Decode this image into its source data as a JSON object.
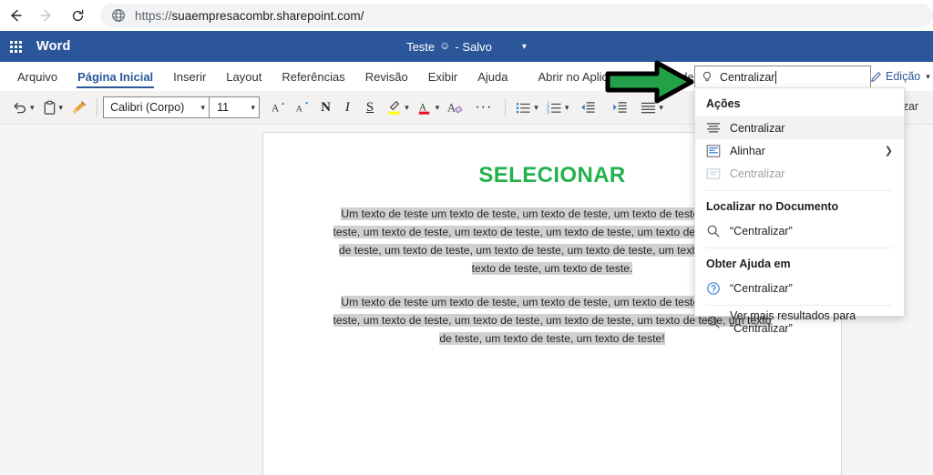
{
  "browser": {
    "back_icon": "arrow-left-icon",
    "forward_icon": "arrow-right-icon",
    "reload_icon": "reload-icon",
    "globe_icon": "globe-icon",
    "url_scheme": "https://",
    "url_host": "suaempresacombr.sharepoint.com/"
  },
  "header": {
    "waffle_icon": "app-launcher-icon",
    "app_name": "Word",
    "doc_name": "Teste",
    "person_icon": "person-icon",
    "save_state": "- Salvo",
    "chevron_icon": "chevron-down-icon"
  },
  "ribbon": {
    "tabs": [
      {
        "label": "Arquivo",
        "active": false
      },
      {
        "label": "Página Inicial",
        "active": true
      },
      {
        "label": "Inserir",
        "active": false
      },
      {
        "label": "Layout",
        "active": false
      },
      {
        "label": "Referências",
        "active": false
      },
      {
        "label": "Revisão",
        "active": false
      },
      {
        "label": "Exibir",
        "active": false
      },
      {
        "label": "Ajuda",
        "active": false
      }
    ],
    "open_in_desktop": "Abrir no Aplicativo da Área de Trabalho",
    "reutilizar_partial": "eutilizar"
  },
  "search": {
    "bulb_icon": "lightbulb-icon",
    "value": "Centralizar"
  },
  "edit_button": {
    "pencil_icon": "pencil-icon",
    "label": "Edição",
    "chevron_icon": "chevron-down-icon"
  },
  "toolbar": {
    "undo_icon": "undo-icon",
    "paste_icon": "paste-icon",
    "format_painter_icon": "format-painter-icon",
    "font_name": "Calibri (Corpo)",
    "font_size": "11",
    "grow_font_icon": "grow-font-icon",
    "shrink_font_icon": "shrink-font-icon",
    "bold_label": "N",
    "italic_label": "I",
    "underline_label": "S",
    "highlight_icon": "text-highlight-icon",
    "font_color_icon": "font-color-icon",
    "clear_format_icon": "clear-formatting-icon",
    "more_label": "···",
    "bullets_icon": "bullet-list-icon",
    "numbering_icon": "numbered-list-icon",
    "decrease_indent_icon": "decrease-indent-icon",
    "increase_indent_icon": "increase-indent-icon",
    "align_icon": "align-icon",
    "highlight_color": "#ffff00",
    "font_color": "#e81123"
  },
  "document": {
    "heading": "SELECIONAR",
    "heading_color": "#22b14c",
    "paragraph1": "Um texto de teste um texto de teste, um texto de teste, um texto de teste, um texto de teste, um texto de teste, um texto de teste, um texto de teste, um texto de teste, um texto de teste, um texto de teste, um texto de teste, um texto de teste, um texto de teste, um texto de teste, um texto de teste.",
    "paragraph2": "Um texto de teste um texto de teste, um texto de teste, um texto de teste, um texto de teste, um texto de teste, um texto de teste, um texto de teste, um texto de teste, um texto de teste, um texto de teste, um texto de teste!",
    "selection_color": "#d0d0d0"
  },
  "search_panel": {
    "actions_header": "Ações",
    "action_centralizar": "Centralizar",
    "action_alinhar": "Alinhar",
    "action_centralizar_disabled": "Centralizar",
    "center_icon": "align-center-icon",
    "align_icon": "align-box-icon",
    "center_disabled_icon": "align-center-disabled-icon",
    "submenu_chevron": "chevron-right-icon",
    "find_header": "Localizar no Documento",
    "find_item": "“Centralizar”",
    "find_icon": "search-icon",
    "help_header": "Obter Ajuda em",
    "help_item": "“Centralizar”",
    "help_icon": "question-circle-icon",
    "more_results": "Ver mais resultados para “Centralizar”",
    "more_results_icon": "search-icon"
  },
  "annotation": {
    "arrow_icon": "green-arrow-right",
    "fill": "#22a148",
    "stroke": "#000000"
  }
}
